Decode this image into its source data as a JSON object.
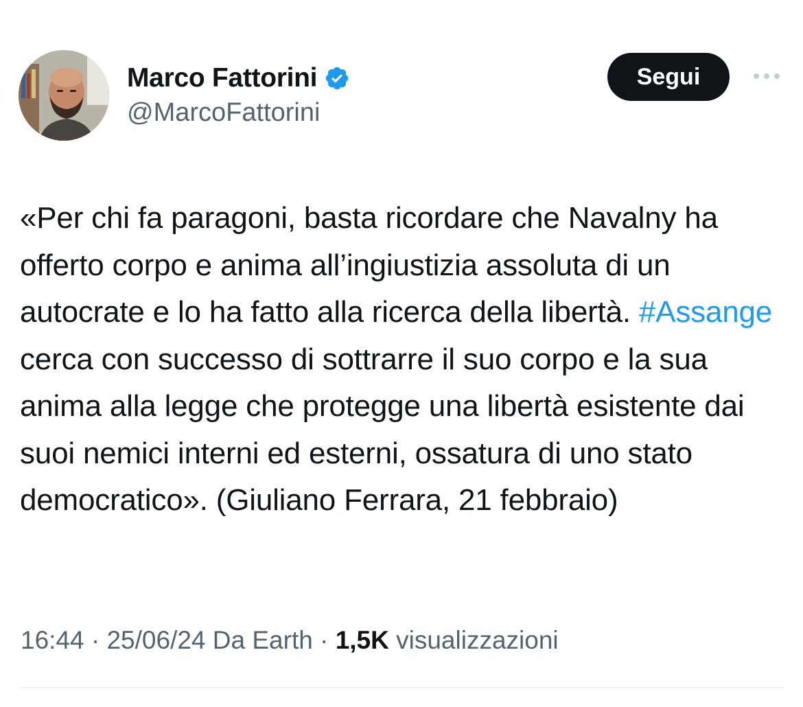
{
  "author": {
    "display_name": "Marco Fattorini",
    "handle": "@MarcoFattorini",
    "verified": true,
    "avatar_icon": "profile-photo"
  },
  "actions": {
    "follow_label": "Segui",
    "more_icon": "more-horizontal-icon"
  },
  "tweet": {
    "text_before": "«Per chi fa paragoni, basta ricordare che Navalny ha offerto corpo e anima all’ingiustizia assoluta di un autocrate e lo ha fatto alla ricerca della libertà. ",
    "hashtag": "#Assange",
    "text_after": " cerca con successo di sottrarre il suo corpo e la sua anima alla legge che protegge una libertà esistente dai suoi nemici interni ed esterni, ossatura di uno stato democratico». (Giuliano Ferrara, 21 febbraio)"
  },
  "meta": {
    "time": "16:44",
    "separator": " · ",
    "date": "25/06/24",
    "source": " Da Earth",
    "views_count": "1,5K",
    "views_label": " visualizzazioni"
  },
  "colors": {
    "text": "#0f1419",
    "secondary": "#536471",
    "accent": "#1d9bf0",
    "button_bg": "#0f1419"
  }
}
